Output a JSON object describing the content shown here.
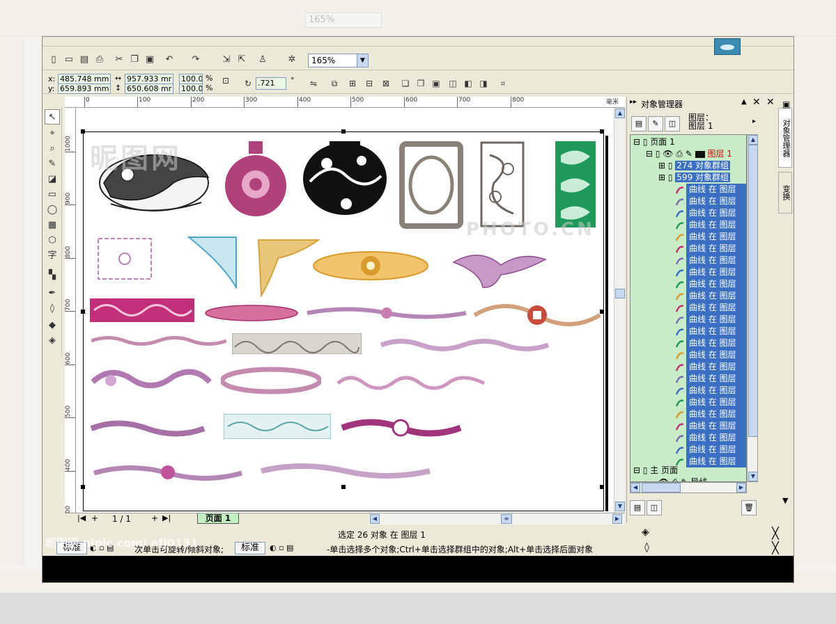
{
  "toolbar": {
    "zoom_value": "165%",
    "zoom_dropdown": "▼"
  },
  "property_bar": {
    "x_label": "x:",
    "y_label": "y:",
    "x_value": "485.748 mm",
    "y_value": "659.893 mm",
    "width_value": "957.933 mr",
    "height_value": "650.608 mr",
    "scale_x": "100.0",
    "scale_y": "100.0",
    "percent": "%",
    "rotation_value": ".721",
    "degree": "°"
  },
  "rulers": {
    "h_ticks": [
      "0",
      "100",
      "200",
      "300",
      "400",
      "500",
      "600",
      "700",
      "800"
    ],
    "h_unit": "毫米",
    "v_ticks": [
      "1000",
      "900",
      "800",
      "700",
      "600",
      "500",
      "400",
      "300"
    ],
    "v_unit": "毫米"
  },
  "page_nav": {
    "count": "1 / 1",
    "tab": "页面 1"
  },
  "status": {
    "selection": "选定 26 对象 在 图层 1",
    "hint_left": "次单击可旋转/倾斜对象;",
    "label_std": "标准",
    "hint_right": "-单击选择多个对象;Ctrl+单击选择群组中的对象;Alt+单击选择后面对象",
    "watermark": "昵图网 nipic.com/ afj0131"
  },
  "object_manager": {
    "title": "对象管理器",
    "layer_label_1": "图层：",
    "layer_label_2": "图层 1",
    "page_node": "页面 1",
    "layer_node": "图层 1",
    "groups": [
      "274 对象群组",
      "599 对象群组"
    ],
    "curve_label": "曲线 在 图层",
    "curve_count": 24,
    "master_node": "主 页面",
    "guides_node": "导线"
  },
  "side_tabs": {
    "tab1": "对象管理器",
    "tab2": "变换"
  },
  "watermark_text": {
    "big": "昵图网",
    "photo": "PHOTO.CN"
  },
  "palette": [
    "#ffffff",
    "#000000",
    "#1a1a1a",
    "#333333",
    "#4d4d4d",
    "#666666",
    "#808080",
    "#999999",
    "#b3b3b3",
    "#cccccc",
    "#e6e6e6",
    "#ffffff",
    "#2a1a6e",
    "#1f4fd6",
    "#1b8fd1",
    "#17a24a",
    "#5ab82c",
    "#ffe400",
    "#f2a0a6",
    "#e8308a",
    "#e8308a",
    "#d94b8c",
    "#f2821f",
    "#f6b7a2",
    "#c28c6a",
    "#a79fbe",
    "#8c85b7",
    "#7874b0",
    "#6e6ba8",
    "#5c5a9c",
    "#8a8cb4",
    "#9c9cc4"
  ],
  "ornament_colors": {
    "fish": "#222222",
    "vase_pink": "#b0417a",
    "vase_black": "#111111",
    "frame_gray": "#8a8176",
    "panel_green": "#1f9a5a",
    "corner_blue": "#4ea6c8",
    "corner_gold": "#d6a43a",
    "gold_band": "#d99a2b",
    "magenta": "#c2307a",
    "lavender": "#b586b5",
    "teal": "#5aa5a8"
  }
}
